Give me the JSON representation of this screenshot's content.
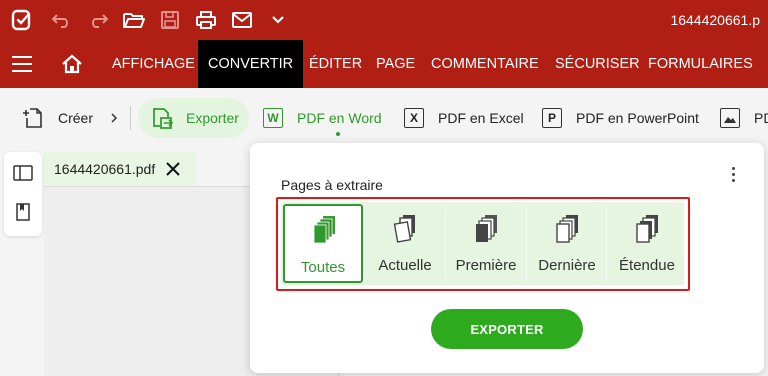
{
  "titlebar": {
    "doc_title": "1644420661.p",
    "icons": [
      "app-logo-icon",
      "undo-icon",
      "redo-icon",
      "open-folder-icon",
      "save-icon",
      "print-icon",
      "mail-icon",
      "chevron-down-icon"
    ]
  },
  "menu": {
    "items": [
      "AFFICHAGE",
      "CONVERTIR",
      "ÉDITER",
      "PAGE",
      "COMMENTAIRE",
      "SÉCURISER",
      "FORMULAIRES"
    ],
    "active": "CONVERTIR"
  },
  "ribbon": {
    "create_label": "Créer",
    "export_label": "Exporter",
    "items": [
      {
        "letter": "W",
        "label": "PDF en Word"
      },
      {
        "letter": "X",
        "label": "PDF en Excel"
      },
      {
        "letter": "P",
        "label": "PDF en PowerPoint"
      },
      {
        "letter": "",
        "label": "PDF"
      }
    ]
  },
  "document_tab": {
    "filename": "1644420661.pdf"
  },
  "popup": {
    "pages_label": "Pages à extraire",
    "options": [
      {
        "label": "Toutes",
        "selected": true
      },
      {
        "label": "Actuelle",
        "selected": false
      },
      {
        "label": "Première",
        "selected": false
      },
      {
        "label": "Dernière",
        "selected": false
      },
      {
        "label": "Étendue",
        "selected": false
      }
    ],
    "export_button": "EXPORTER"
  },
  "colors": {
    "brand_red": "#b01e14",
    "accent_green": "#2f9a2c",
    "highlight_red": "#d81b1b",
    "button_green": "#2eaa1f"
  }
}
